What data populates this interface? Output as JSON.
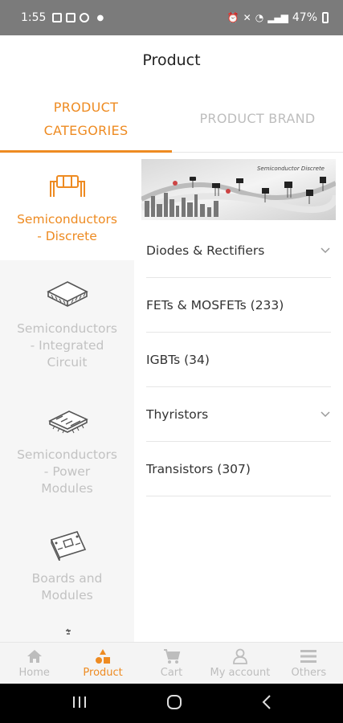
{
  "status_bar": {
    "time": "1:55",
    "battery": "47%"
  },
  "header": {
    "title": "Product"
  },
  "tabs": [
    {
      "label": "PRODUCT CATEGORIES",
      "line1": "PRODUCT",
      "line2": "CATEGORIES",
      "active": true
    },
    {
      "label": "PRODUCT BRAND",
      "active": false
    }
  ],
  "sidebar": {
    "items": [
      {
        "line1": "Semiconductors",
        "line2": "- Discrete",
        "active": true,
        "icon": "discrete-chip-icon"
      },
      {
        "line1": "Semiconductors",
        "line2": "- Integrated",
        "line3": "Circuit",
        "active": false,
        "icon": "ic-chip-icon"
      },
      {
        "line1": "Semiconductors",
        "line2": "- Power",
        "line3": "Modules",
        "active": false,
        "icon": "power-module-icon"
      },
      {
        "line1": "Boards and",
        "line2": "Modules",
        "active": false,
        "icon": "board-icon"
      },
      {
        "active": false,
        "icon": "partial-icon"
      }
    ]
  },
  "banner": {
    "text": "Semiconductor Discrete"
  },
  "subcategories": [
    {
      "label": "Diodes & Rectifiers",
      "expandable": true
    },
    {
      "label": "FETs & MOSFETs (233)",
      "expandable": false
    },
    {
      "label": "IGBTs (34)",
      "expandable": false
    },
    {
      "label": "Thyristors",
      "expandable": true
    },
    {
      "label": "Transistors (307)",
      "expandable": false
    }
  ],
  "bottom_nav": [
    {
      "label": "Home",
      "icon": "home-icon",
      "active": false
    },
    {
      "label": "Product",
      "icon": "product-icon",
      "active": true
    },
    {
      "label": "Cart",
      "icon": "cart-icon",
      "active": false
    },
    {
      "label": "My account",
      "icon": "account-icon",
      "active": false
    },
    {
      "label": "Others",
      "icon": "menu-icon",
      "active": false
    }
  ],
  "colors": {
    "accent": "#ee8b22",
    "inactive": "#bdbdbd"
  }
}
